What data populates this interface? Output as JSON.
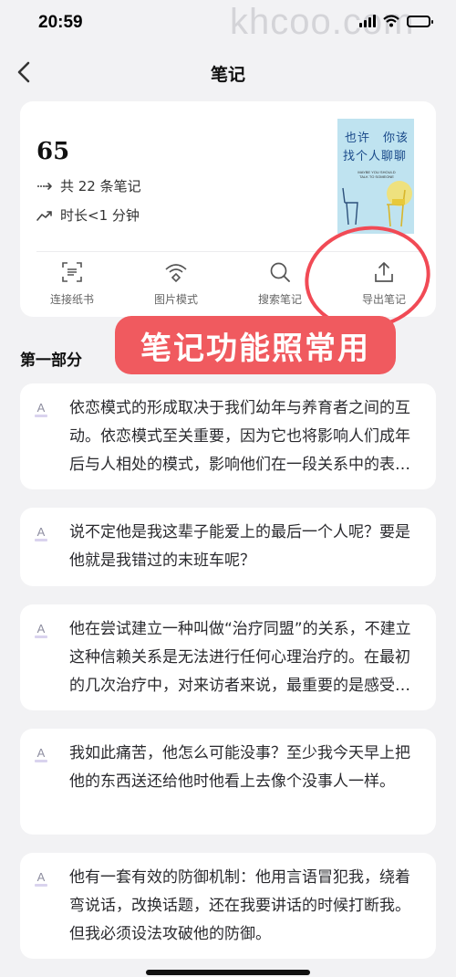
{
  "status_bar": {
    "time": "20:59",
    "watermark": "khcoo.com"
  },
  "nav": {
    "title": "笔记",
    "back_icon": "chevron-left-icon"
  },
  "summary": {
    "count": "65",
    "total_notes": "共 22 条笔记",
    "duration": "时长<1 分钟"
  },
  "book_cover": {
    "title_line1": "也许　你该",
    "title_line2": "找个人聊聊",
    "subtitle": "MAYBE YOU SHOULD TALK TO SOMEONE",
    "color": "#bfe3f0"
  },
  "actions": [
    {
      "label": "连接纸书",
      "icon": "scan-icon"
    },
    {
      "label": "图片模式",
      "icon": "image-mode-icon"
    },
    {
      "label": "搜索笔记",
      "icon": "search-icon"
    },
    {
      "label": "导出笔记",
      "icon": "export-icon"
    }
  ],
  "overlay": {
    "banner": "笔记功能照常用",
    "accent": "#f05a5f"
  },
  "section": {
    "title": "第一部分"
  },
  "notes": [
    {
      "text": "依恋模式的形成取决于我们幼年与养育者之间的互动。依恋模式至关重要，因为它也将影响人们成年后与人相处的模式，影响他们在一段关系中的表现。"
    },
    {
      "text": "说不定他是我这辈子能爱上的最后一个人呢？要是他就是我错过的末班车呢？"
    },
    {
      "text": "他在尝试建立一种叫做“治疗同盟”的关系，不建立这种信赖关系是无法进行任何心理治疗的。在最初的几次治疗中，对来访者来说，最重要的是感受到被理解。"
    },
    {
      "text": "我如此痛苦，他怎么可能没事？至少我今天早上把他的东西送还给他时他看上去像个没事人一样。"
    },
    {
      "text": "他有一套有效的防御机制：他用言语冒犯我，绕着弯说话，改换话题，还在我要讲话的时候打断我。但我必须设法攻破他的防御。"
    }
  ]
}
